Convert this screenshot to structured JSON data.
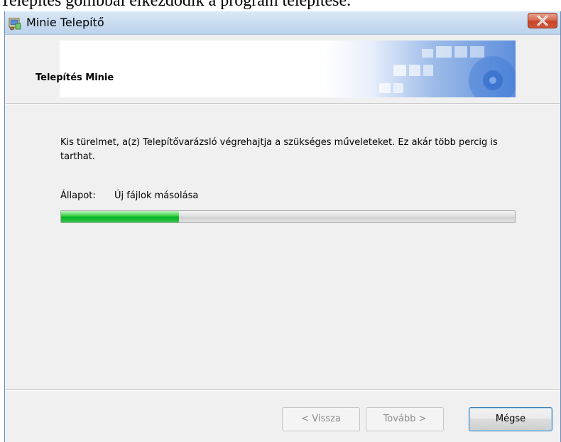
{
  "caption": {
    "text": "Telepítés gombbal elkezdődik a program telepítése."
  },
  "window": {
    "title": "Minie Telepítő",
    "app_icon": "installer-icon",
    "close_icon": "close-icon"
  },
  "banner": {
    "title": "Telepítés Minie"
  },
  "content": {
    "message": "Kis türelmet, a(z) Telepítővarázsló végrehajtja a szükséges műveleteket. Ez akár több percig is tarthat.",
    "status_label": "Állapot:",
    "status_value": "Új fájlok másolása",
    "progress_percent": 26
  },
  "buttons": {
    "back": "< Vissza",
    "next": "Tovább >",
    "cancel": "Mégse"
  },
  "colors": {
    "progress_green": "#06b025",
    "close_red": "#c7452a",
    "title_bar": "#c9dcf0",
    "window_bg": "#f0f0f0"
  }
}
